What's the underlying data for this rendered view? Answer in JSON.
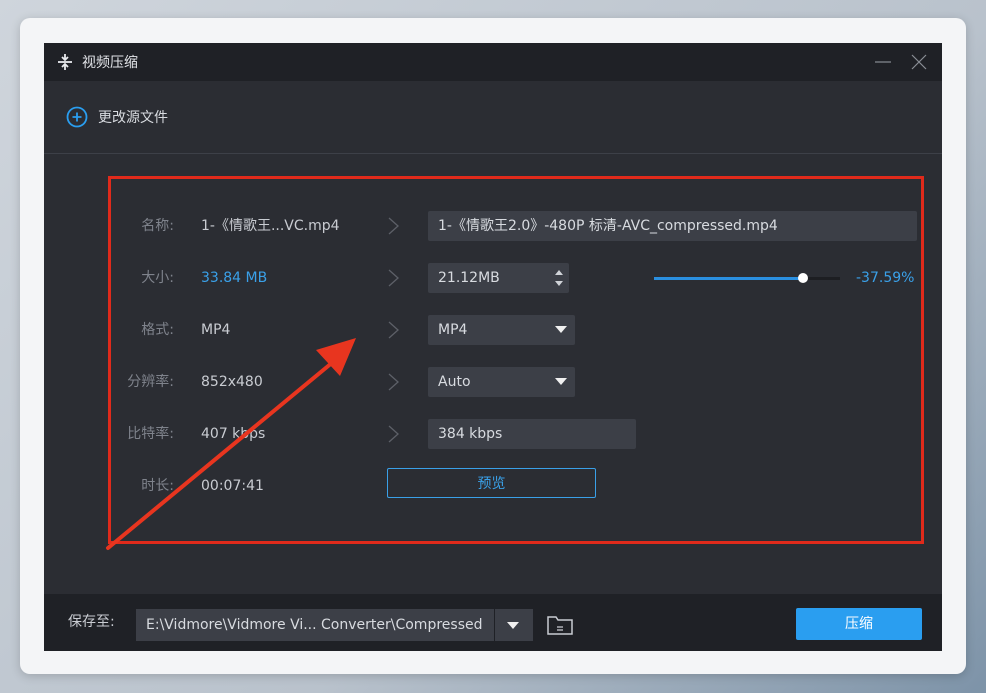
{
  "window": {
    "title": "视频压缩"
  },
  "source": {
    "change_label": "更改源文件"
  },
  "rows": {
    "name": {
      "label": "名称:",
      "original": "1-《情歌王...VC.mp4",
      "output": "1-《情歌王2.0》-480P 标清-AVC_compressed.mp4"
    },
    "size": {
      "label": "大小:",
      "original": "33.84 MB",
      "output": "21.12MB",
      "ratio_fraction": 0.8,
      "percent_text": "-37.59%"
    },
    "format": {
      "label": "格式:",
      "original": "MP4",
      "selected": "MP4"
    },
    "resolution": {
      "label": "分辨率:",
      "original": "852x480",
      "selected": "Auto"
    },
    "bitrate": {
      "label": "比特率:",
      "original": "407 kbps",
      "output": "384 kbps"
    },
    "duration": {
      "label": "时长:",
      "original": "00:07:41"
    }
  },
  "preview": {
    "label": "预览"
  },
  "footer": {
    "save_label": "保存至:",
    "path": "E:\\Vidmore\\Vidmore Vi... Converter\\Compressed",
    "compress_label": "压缩"
  },
  "colors": {
    "accent": "#2a9ef0",
    "highlight_box": "#e02a1b",
    "annotation_arrow": "#e8351f"
  },
  "icons": [
    "compress-icon",
    "minimize-icon",
    "close-icon",
    "add-circle-icon",
    "chevron-right-icon",
    "spinner-icon",
    "dropdown-caret-icon",
    "folder-icon"
  ]
}
